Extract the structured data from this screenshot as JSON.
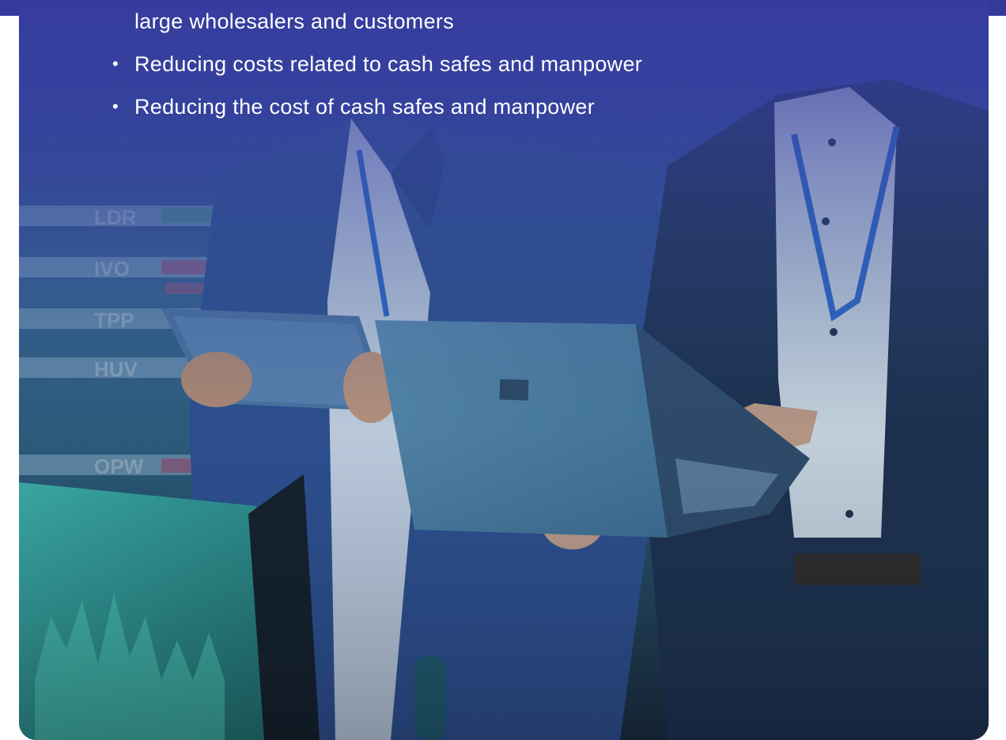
{
  "bullets": {
    "continuation": "large wholesalers and customers",
    "items": [
      "Reducing costs related to cash safes and manpower",
      "Reducing the cost of cash safes and manpower"
    ]
  },
  "ticker": {
    "labels": [
      "LDR",
      "IVO",
      "TPP",
      "HUV",
      "OPW"
    ]
  },
  "colors": {
    "overlay": "#343a9c",
    "text": "#ffffff"
  },
  "illustration": "two-businessmen-with-tablet-and-laptop"
}
